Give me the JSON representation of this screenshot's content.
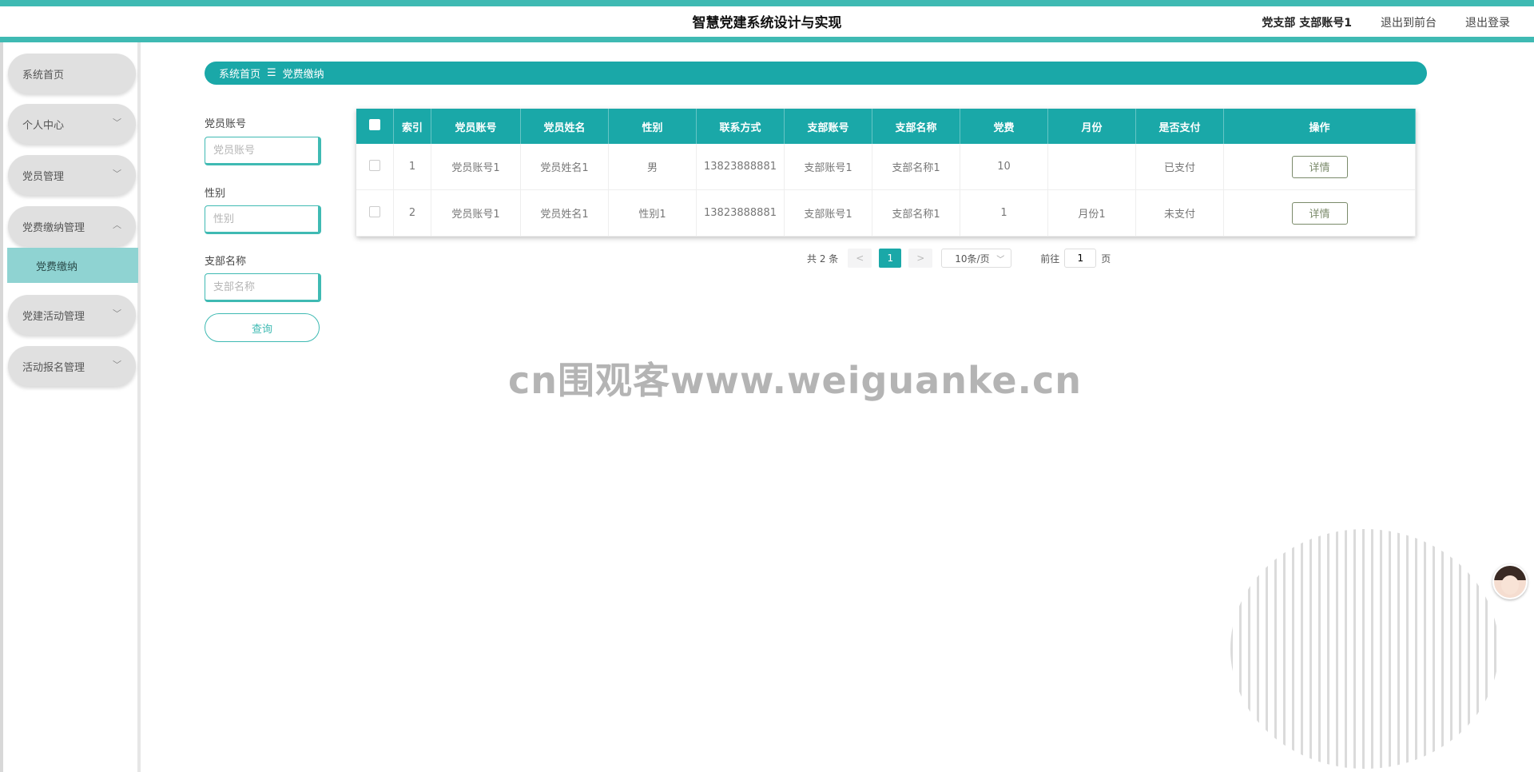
{
  "header": {
    "title": "智慧党建系统设计与实现",
    "user": "党支部 支部账号1",
    "to_front": "退出到前台",
    "logout": "退出登录"
  },
  "sidebar": {
    "items": [
      {
        "label": "系统首页"
      },
      {
        "label": "个人中心"
      },
      {
        "label": "党员管理"
      },
      {
        "label": "党费缴纳管理"
      },
      {
        "label": "党费缴纳"
      },
      {
        "label": "党建活动管理"
      },
      {
        "label": "活动报名管理"
      }
    ]
  },
  "breadcrumb": {
    "home": "系统首页",
    "sep": "☰",
    "current": "党费缴纳"
  },
  "search": {
    "account_label": "党员账号",
    "account_placeholder": "党员账号",
    "gender_label": "性别",
    "gender_placeholder": "性别",
    "branch_label": "支部名称",
    "branch_placeholder": "支部名称",
    "query_label": "查询"
  },
  "table": {
    "headers": [
      "索引",
      "党员账号",
      "党员姓名",
      "性别",
      "联系方式",
      "支部账号",
      "支部名称",
      "党费",
      "月份",
      "是否支付",
      "操作"
    ],
    "rows": [
      [
        "1",
        "党员账号1",
        "党员姓名1",
        "男",
        "13823888881",
        "支部账号1",
        "支部名称1",
        "10",
        "",
        "已支付"
      ],
      [
        "2",
        "党员账号1",
        "党员姓名1",
        "性别1",
        "13823888881",
        "支部账号1",
        "支部名称1",
        "1",
        "月份1",
        "未支付"
      ]
    ],
    "detail_label": "详情"
  },
  "pager": {
    "total": "共 2 条",
    "prev": "<",
    "page": "1",
    "next": ">",
    "size": "10条/页",
    "goto_prefix": "前往",
    "goto_value": "1",
    "goto_suffix": "页"
  },
  "watermark": "cn围观客www.weiguanke.cn"
}
